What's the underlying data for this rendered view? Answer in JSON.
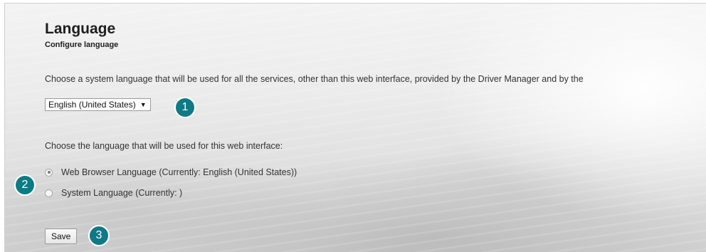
{
  "header": {
    "title": "Language",
    "subtitle": "Configure language"
  },
  "system_language": {
    "description": "Choose a system language that will be used for all the services, other than this web interface, provided by the Driver Manager and by the",
    "selected": "English (United States)"
  },
  "web_language": {
    "description": "Choose the language that will be used for this web interface:",
    "options": [
      {
        "label": "Web Browser Language (Currently: English (United States))",
        "checked": true
      },
      {
        "label": "System Language (Currently: )",
        "checked": false
      }
    ]
  },
  "actions": {
    "save_label": "Save"
  },
  "callouts": [
    "1",
    "2",
    "3"
  ],
  "colors": {
    "callout": "#0f7a86"
  }
}
